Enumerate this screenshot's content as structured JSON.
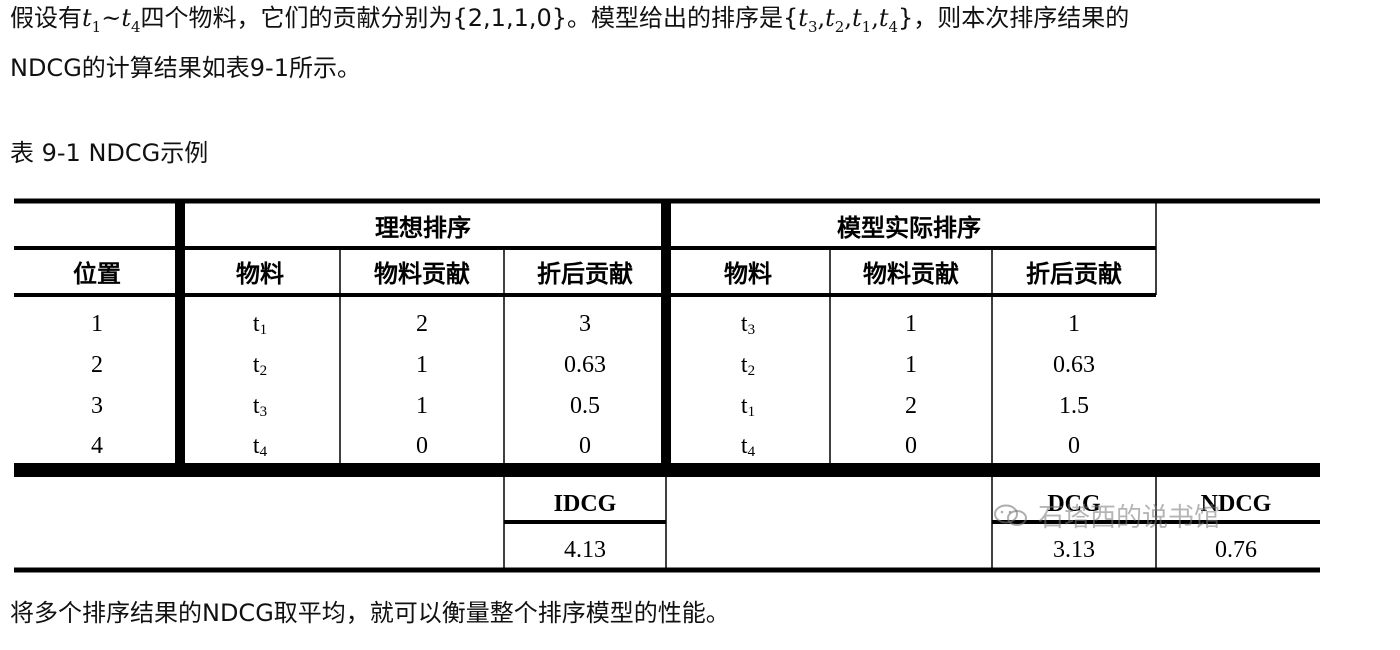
{
  "text": {
    "p1_a": "假设有",
    "p1_range_start": "t",
    "p1_range_start_sub": "1",
    "p1_tilde": "~",
    "p1_range_end": "t",
    "p1_range_end_sub": "4",
    "p1_b": "四个物料，它们的贡献分别为{2,1,1,0}。模型给出的排序是{",
    "p1_order": [
      {
        "base": "t",
        "sub": "3"
      },
      {
        "base": "t",
        "sub": "2"
      },
      {
        "base": "t",
        "sub": "1"
      },
      {
        "base": "t",
        "sub": "4"
      }
    ],
    "p1_c": "}，则本次排序结果的",
    "p2": "NDCG的计算结果如表9-1所示。",
    "caption": "表 9-1 NDCG示例",
    "p3": "将多个排序结果的NDCG取平均，就可以衡量整个排序模型的性能。"
  },
  "table": {
    "group_ideal": "理想排序",
    "group_model": "模型实际排序",
    "col_position": "位置",
    "col_item": "物料",
    "col_contrib": "物料贡献",
    "col_discount": "折后贡献",
    "rows": [
      {
        "pos": "1",
        "ideal_item": "t",
        "ideal_item_sub": "1",
        "ideal_contrib": "2",
        "ideal_disc": "3",
        "model_item": "t",
        "model_item_sub": "3",
        "model_contrib": "1",
        "model_disc": "1"
      },
      {
        "pos": "2",
        "ideal_item": "t",
        "ideal_item_sub": "2",
        "ideal_contrib": "1",
        "ideal_disc": "0.63",
        "model_item": "t",
        "model_item_sub": "2",
        "model_contrib": "1",
        "model_disc": "0.63"
      },
      {
        "pos": "3",
        "ideal_item": "t",
        "ideal_item_sub": "3",
        "ideal_contrib": "1",
        "ideal_disc": "0.5",
        "model_item": "t",
        "model_item_sub": "1",
        "model_contrib": "2",
        "model_disc": "1.5"
      },
      {
        "pos": "4",
        "ideal_item": "t",
        "ideal_item_sub": "4",
        "ideal_contrib": "0",
        "ideal_disc": "0",
        "model_item": "t",
        "model_item_sub": "4",
        "model_contrib": "0",
        "model_disc": "0"
      }
    ],
    "idcg_label": "IDCG",
    "idcg_value": "4.13",
    "dcg_label": "DCG",
    "dcg_value": "3.13",
    "ndcg_label": "NDCG",
    "ndcg_value": "0.76"
  },
  "watermark": {
    "text": "石塔西的说书馆",
    "icon": "wechat-icon"
  }
}
